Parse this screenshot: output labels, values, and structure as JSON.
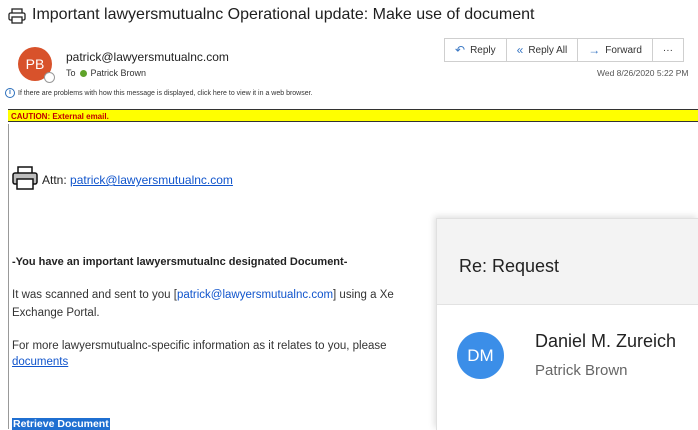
{
  "email": {
    "subject": "Important lawyersmutualnc Operational update: Make use of document",
    "sender_initials": "PB",
    "sender_address": "patrick@lawyersmutualnc.com",
    "to_label": "To",
    "to_name": "Patrick Brown",
    "date": "Wed 8/26/2020 5:22 PM",
    "info_bar": "If there are problems with how this message is displayed, click here to view it in a web browser.",
    "caution": "CAUTION: External email."
  },
  "toolbar": {
    "reply_label": "Reply",
    "reply_all_label": "Reply All",
    "forward_label": "Forward",
    "more_label": "···"
  },
  "body": {
    "attn_label": "Attn:",
    "attn_link": "patrick@lawyersmutualnc.com",
    "important_line": "-You have an important lawyersmutualnc designated Document-",
    "scanned_pre": "It was scanned and sent to you [",
    "scanned_addr": "patrick@lawyersmutualnc.com",
    "scanned_post": "] using a Xe",
    "exchange_line": "Exchange Portal.",
    "more_info": "For more lawyersmutualnc-specific information as it relates to you, please",
    "documents_link": "documents",
    "retrieve_button": "Retrieve Document"
  },
  "overlay_card": {
    "subject": "Re: Request",
    "avatar_initials": "DM",
    "sender": "Daniel M. Zureich",
    "recipient": "Patrick Brown",
    "avatar_color": "#3b8ee8"
  },
  "icons": {
    "print": "printer-icon",
    "reply": "reply-icon",
    "reply_all": "reply-all-icon",
    "forward": "forward-icon",
    "info": "info-icon"
  }
}
